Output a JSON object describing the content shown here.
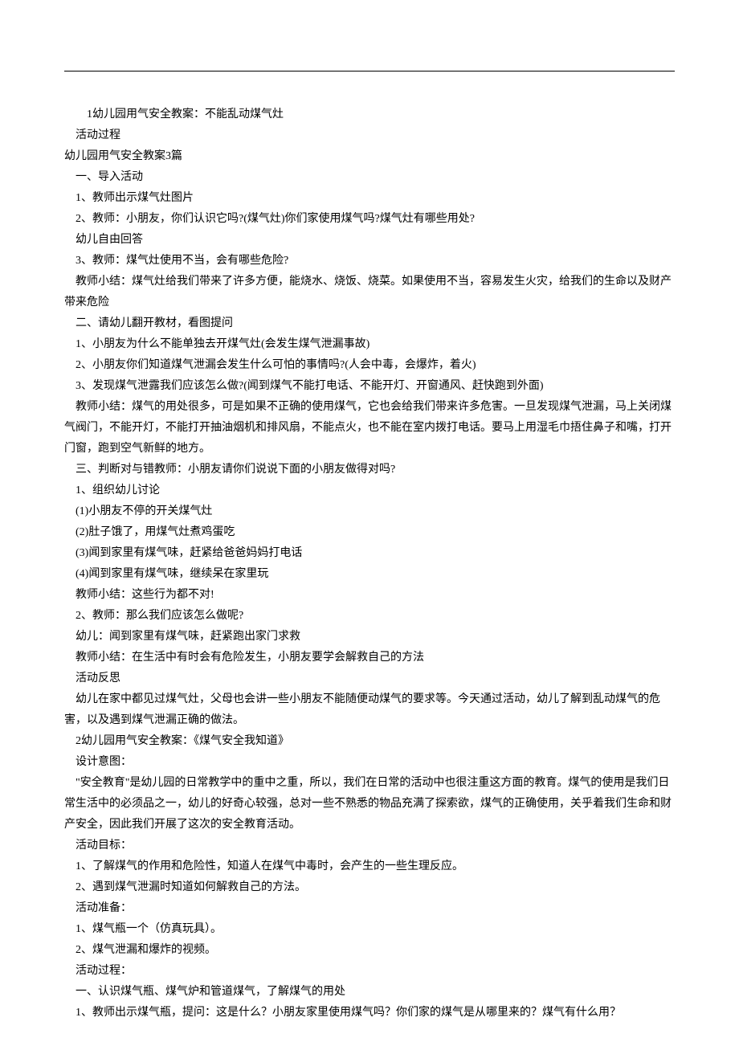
{
  "lines": [
    {
      "cls": "p-indent-2",
      "text": "1幼儿园用气安全教案：不能乱动煤气灶"
    },
    {
      "cls": "p-indent-1",
      "text": "活动过程"
    },
    {
      "cls": "p-noindent",
      "text": "幼儿园用气安全教案3篇"
    },
    {
      "cls": "p-indent-1",
      "text": "一、导入活动"
    },
    {
      "cls": "p-indent-1",
      "text": "1、教师出示煤气灶图片"
    },
    {
      "cls": "p-indent-1",
      "text": "2、教师：小朋友，你们认识它吗?(煤气灶)你们家使用煤气吗?煤气灶有哪些用处?"
    },
    {
      "cls": "p-indent-1",
      "text": "幼儿自由回答"
    },
    {
      "cls": "p-indent-1",
      "text": "3、教师：煤气灶使用不当，会有哪些危险?"
    },
    {
      "cls": "p-indent-1",
      "text": "教师小结：煤气灶给我们带来了许多方便，能烧水、烧饭、烧菜。如果使用不当，容易发生火灾，给我们的生命以及财产带来危险"
    },
    {
      "cls": "p-indent-1",
      "text": "二、请幼儿翻开教材，看图提问"
    },
    {
      "cls": "p-indent-1",
      "text": "1、小朋友为什么不能单独去开煤气灶(会发生煤气泄漏事故)"
    },
    {
      "cls": "p-indent-1",
      "text": "2、小朋友你们知道煤气泄漏会发生什么可怕的事情吗?(人会中毒，会爆炸，着火)"
    },
    {
      "cls": "p-indent-1",
      "text": "3、发现煤气泄露我们应该怎么做?(闻到煤气不能打电话、不能开灯、开窗通风、赶快跑到外面)"
    },
    {
      "cls": "p-indent-1",
      "text": "教师小结：煤气的用处很多，可是如果不正确的使用煤气，它也会给我们带来许多危害。一旦发现煤气泄漏，马上关闭煤气阀门，不能开灯，不能打开抽油烟机和排风扇，不能点火，也不能在室内拨打电话。要马上用湿毛巾捂住鼻子和嘴，打开门窗，跑到空气新鲜的地方。"
    },
    {
      "cls": "p-indent-1",
      "text": "三、判断对与错教师：小朋友请你们说说下面的小朋友做得对吗?"
    },
    {
      "cls": "p-indent-1",
      "text": "1、组织幼儿讨论"
    },
    {
      "cls": "p-indent-1",
      "text": "(1)小朋友不停的开关煤气灶"
    },
    {
      "cls": "p-indent-1",
      "text": "(2)肚子饿了，用煤气灶煮鸡蛋吃"
    },
    {
      "cls": "p-indent-1",
      "text": "(3)闻到家里有煤气味，赶紧给爸爸妈妈打电话"
    },
    {
      "cls": "p-indent-1",
      "text": "(4)闻到家里有煤气味，继续呆在家里玩"
    },
    {
      "cls": "p-indent-1",
      "text": "教师小结：这些行为都不对!"
    },
    {
      "cls": "p-indent-1",
      "text": "2、教师：那么我们应该怎么做呢?"
    },
    {
      "cls": "p-indent-1",
      "text": "幼儿：闻到家里有煤气味，赶紧跑出家门求救"
    },
    {
      "cls": "p-indent-1",
      "text": "教师小结：在生活中有时会有危险发生，小朋友要学会解救自己的方法"
    },
    {
      "cls": "p-indent-1",
      "text": "活动反思"
    },
    {
      "cls": "p-indent-1",
      "text": "幼儿在家中都见过煤气灶，父母也会讲一些小朋友不能随便动煤气的要求等。今天通过活动，幼儿了解到乱动煤气的危害，以及遇到煤气泄漏正确的做法。"
    },
    {
      "cls": "p-indent-1",
      "text": "2幼儿园用气安全教案：《煤气安全我知道》"
    },
    {
      "cls": "p-indent-1",
      "text": "设计意图："
    },
    {
      "cls": "p-indent-1",
      "text": "\"安全教育\"是幼儿园的日常教学中的重中之重，所以，我们在日常的活动中也很注重这方面的教育。煤气的使用是我们日常生活中的必须品之一，幼儿的好奇心较强，总对一些不熟悉的物品充满了探索欲，煤气的正确使用，关乎着我们生命和财产安全，因此我们开展了这次的安全教育活动。"
    },
    {
      "cls": "p-indent-1",
      "text": "活动目标："
    },
    {
      "cls": "p-indent-1",
      "text": "1、了解煤气的作用和危险性，知道人在煤气中毒时，会产生的一些生理反应。"
    },
    {
      "cls": "p-indent-1",
      "text": "2、遇到煤气泄漏时知道如何解救自己的方法。"
    },
    {
      "cls": "p-indent-1",
      "text": "活动准备："
    },
    {
      "cls": "p-indent-1",
      "text": "1、煤气瓶一个（仿真玩具）。"
    },
    {
      "cls": "p-indent-1",
      "text": "2、煤气泄漏和爆炸的视频。"
    },
    {
      "cls": "p-indent-1",
      "text": "活动过程："
    },
    {
      "cls": "p-indent-1",
      "text": "一、认识煤气瓶、煤气炉和管道煤气，了解煤气的用处"
    },
    {
      "cls": "p-indent-1",
      "text": "1、教师出示煤气瓶，提问：这是什么？小朋友家里使用煤气吗？你们家的煤气是从哪里来的？煤气有什么用？"
    }
  ]
}
